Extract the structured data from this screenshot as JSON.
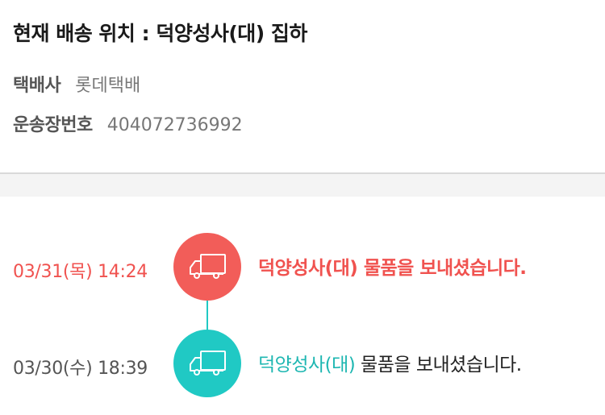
{
  "header": {
    "title": "현재 배송 위치 : 덕양성사(대) 집하",
    "courier_label": "택배사",
    "courier_value": "롯데택배",
    "tracking_label": "운송장번호",
    "tracking_value": "404072736992"
  },
  "colors": {
    "latest": "#f25d59",
    "previous": "#20c9c4"
  },
  "events": [
    {
      "time": "03/31(목) 14:24",
      "location": "덕양성사(대)",
      "message": " 물품을 보내셨습니다.",
      "icon": "truck-icon"
    },
    {
      "time": "03/30(수) 18:39",
      "location": "덕양성사(대)",
      "message": " 물품을 보내셨습니다.",
      "icon": "truck-icon"
    }
  ]
}
